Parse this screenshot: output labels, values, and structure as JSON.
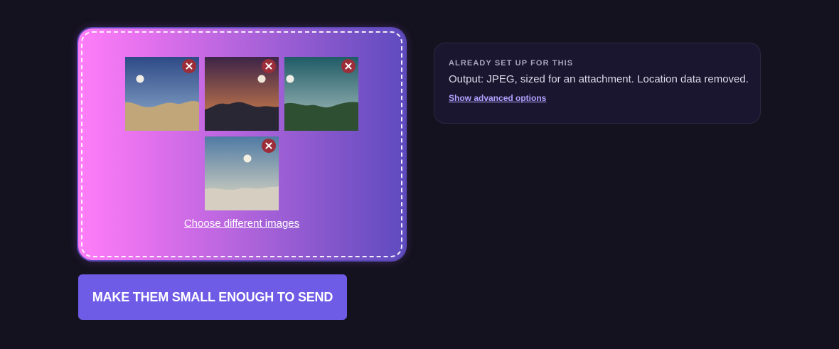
{
  "dropzone": {
    "images": [
      {
        "remove_icon": "close-icon",
        "scene": "day-desert",
        "colors": {
          "sky_top": "#2e4a86",
          "sky_bottom": "#94b1d2",
          "ground": "#c0a678",
          "sun": "#f1ede4"
        }
      },
      {
        "remove_icon": "close-icon",
        "scene": "sunset-mountains",
        "colors": {
          "sky_top": "#3d2448",
          "sky_bottom": "#e08a4c",
          "ground": "#292733",
          "sun": "#efe7d8"
        }
      },
      {
        "remove_icon": "close-icon",
        "scene": "teal-hills",
        "colors": {
          "sky_top": "#1f5b66",
          "sky_bottom": "#b0c6c4",
          "ground": "#2f4f33",
          "sun": "#eeeee6"
        }
      },
      {
        "remove_icon": "close-icon",
        "scene": "hazy-dunes",
        "colors": {
          "sky_top": "#4f7aa4",
          "sky_bottom": "#e6dec4",
          "ground": "#d6cec0",
          "sun": "#f5efe2"
        }
      }
    ],
    "choose_link": "Choose different images"
  },
  "send_button": {
    "label": "MAKE THEM SMALL ENOUGH TO SEND"
  },
  "info_card": {
    "heading": "ALREADY SET UP FOR THIS",
    "text": "Output: JPEG, sized for an attachment. Location data removed.",
    "advanced_link": "Show advanced options"
  },
  "colors": {
    "page_background": "#14121e",
    "gradient_start": "#ff7ef8",
    "gradient_end": "#5e4bbf",
    "button": "#6e5be6",
    "card_background": "#1b1630",
    "link": "#b1a2ff",
    "remove_button": "#9c2e3a"
  }
}
